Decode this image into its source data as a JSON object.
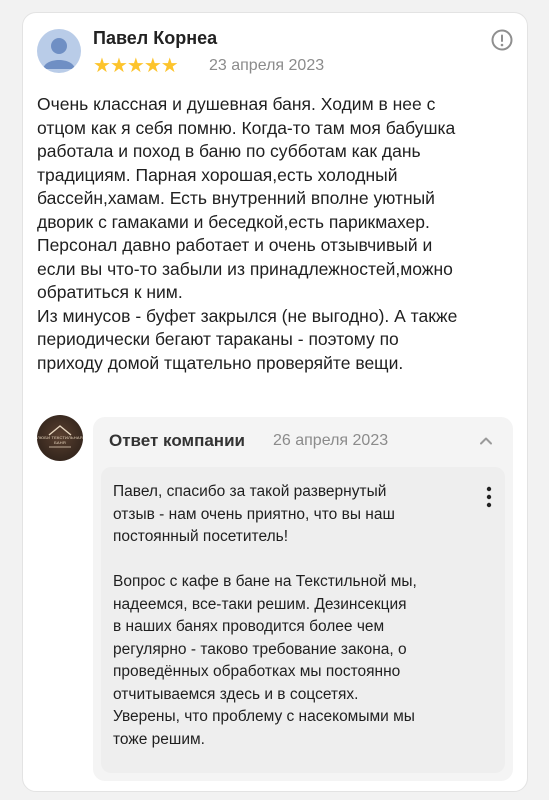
{
  "review": {
    "author": "Павел Корнеа",
    "rating": 5,
    "stars": [
      "★",
      "★",
      "★",
      "★",
      "★"
    ],
    "date": "23 апреля 2023",
    "text": "Очень классная и душевная баня. Ходим в нее с\nотцом как я себя помню. Когда-то там моя бабушка\nработала и поход в баню по субботам как дань\nтрадициям. Парная хорошая,есть холодный\nбассейн,хамам. Есть внутренний вполне уютный\nдворик с гамаками и беседкой,есть парикмахер.\nПерсонал давно работает и очень отзывчивый и\nесли вы что-то забыли из принадлежностей,можно\nобратиться к ним.\nИз минусов - буфет закрылся (не выгодно). А также\nпериодически бегают тараканы - поэтому по\nприходу домой тщательно проверяйте вещи."
  },
  "reply": {
    "title": "Ответ компании",
    "date": "26 апреля 2023",
    "logo_text": "ЛЮБИ ТЕКСТИЛЬНАЯ БАНЯ",
    "text": "Павел, спасибо за такой развернутый\nотзыв - нам очень приятно, что вы наш\nпостоянный посетитель!\n\nВопрос с кафе в бане на Текстильной мы,\nнадеемся, все-таки решим. Дезинсекция\nв наших банях проводится более чем\nрегулярно - таково требование закона, о\nпроведённых обработках мы постоянно\nотчитываемся здесь и в соцсетях.\nУверены, что проблему с насекомыми мы\nтоже решим."
  },
  "icons": {
    "report": "exclamation-circle-icon",
    "collapse": "chevron-up-icon",
    "more": "vertical-dots-icon"
  },
  "colors": {
    "star": "#fdc42c",
    "muted": "#8b8b8b",
    "avatar": "#b9cce8"
  }
}
